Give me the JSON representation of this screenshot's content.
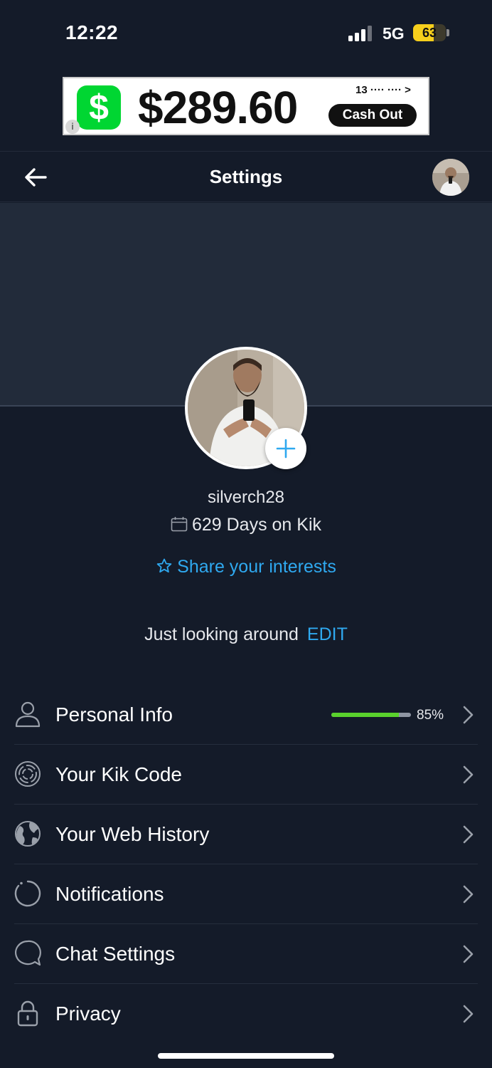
{
  "status": {
    "time": "12:22",
    "network": "5G",
    "battery": "63"
  },
  "ad": {
    "amount": "$289.60",
    "small_text": "13 ···· ···· >",
    "button": "Cash Out",
    "info": "i"
  },
  "nav": {
    "title": "Settings"
  },
  "profile": {
    "username": "silverch28",
    "days": "629 Days on Kik",
    "interests": "Share your interests",
    "mood": "Just looking around",
    "edit": "EDIT"
  },
  "menu": [
    {
      "label": "Personal Info",
      "icon": "person-icon",
      "progress": 0.85,
      "progress_text": "85%"
    },
    {
      "label": "Your Kik Code",
      "icon": "kik-code-icon"
    },
    {
      "label": "Your Web History",
      "icon": "globe-icon"
    },
    {
      "label": "Notifications",
      "icon": "notification-icon"
    },
    {
      "label": "Chat Settings",
      "icon": "chat-bubble-icon"
    },
    {
      "label": "Privacy",
      "icon": "lock-icon"
    }
  ],
  "colors": {
    "background": "#141b29",
    "accent": "#2fa9f0",
    "progress": "#5ad22d",
    "battery": "#f7cf1c"
  }
}
